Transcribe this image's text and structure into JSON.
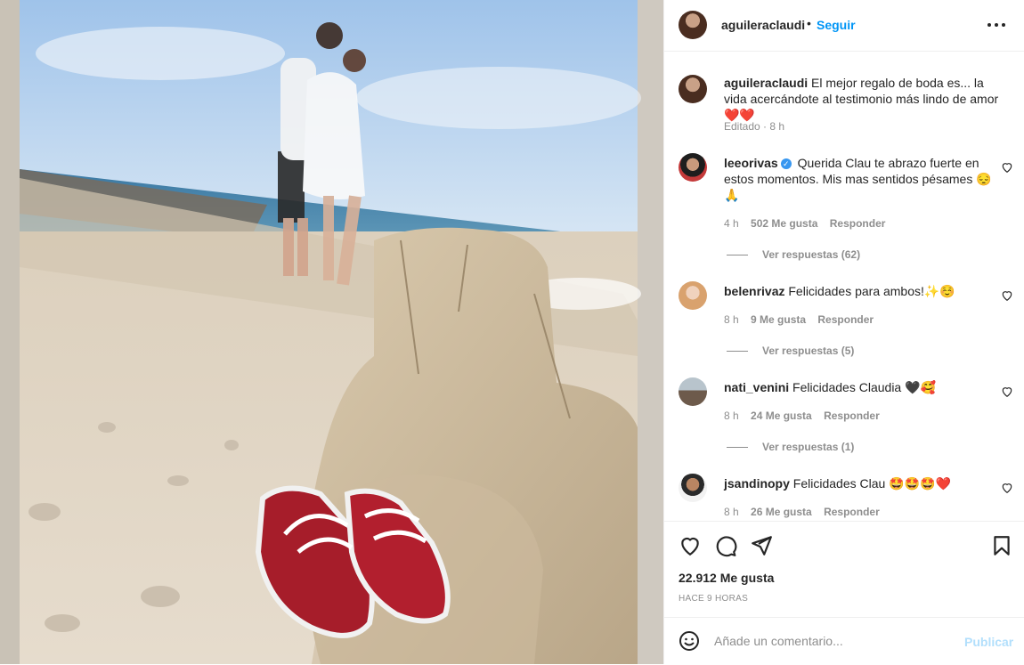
{
  "post": {
    "username": "aguileraclaudi",
    "separator": "•",
    "follow_label": "Seguir",
    "caption_user": "aguileraclaudi",
    "caption_text": "El mejor regalo de boda es... la vida acercándote al testimonio más lindo de amor ❤️❤️",
    "caption_meta": "Editado · 8 h"
  },
  "comments": [
    {
      "user": "leeorivas",
      "verified": true,
      "text": "Querida Clau te abrazo fuerte en estos momentos. Mis mas sentidos pésames 😔🙏",
      "age": "4 h",
      "likes": "502 Me gusta",
      "reply": "Responder",
      "view_replies": "Ver respuestas (62)"
    },
    {
      "user": "belenrivaz",
      "verified": false,
      "text": "Felicidades para ambos!✨☺️",
      "age": "8 h",
      "likes": "9 Me gusta",
      "reply": "Responder",
      "view_replies": "Ver respuestas (5)"
    },
    {
      "user": "nati_venini",
      "verified": false,
      "text": "Felicidades Claudia 🖤🥰",
      "age": "8 h",
      "likes": "24 Me gusta",
      "reply": "Responder",
      "view_replies": "Ver respuestas (1)"
    },
    {
      "user": "jsandinopy",
      "verified": false,
      "text": "Felicidades Clau 🤩🤩🤩❤️",
      "age": "8 h",
      "likes": "26 Me gusta",
      "reply": "Responder"
    }
  ],
  "footer": {
    "likes": "22.912 Me gusta",
    "time": "HACE 9 HORAS",
    "comment_placeholder": "Añade un comentario...",
    "publish_label": "Publicar"
  },
  "colors": {
    "accent": "#0095f6",
    "publish_disabled": "#b2dffc",
    "text": "#262626",
    "muted": "#8e8e8e",
    "verified": "#3897f0"
  },
  "icons": [
    "more-options-icon",
    "like-heart-icon",
    "comment-icon",
    "share-icon",
    "save-bookmark-icon",
    "emoji-icon",
    "comment-like-icon",
    "verified-badge-icon"
  ]
}
